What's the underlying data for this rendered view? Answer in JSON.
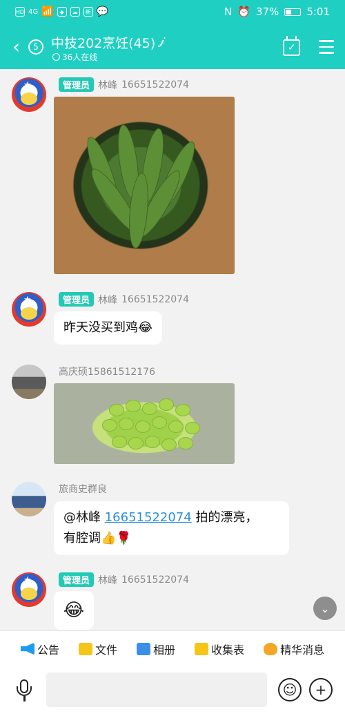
{
  "statusbar": {
    "battery": "37%",
    "time": "5:01",
    "signal": "4G"
  },
  "header": {
    "unread": "5",
    "title": "中技202烹饪(45)",
    "online": "36人在线"
  },
  "messages": [
    {
      "badge": "管理员",
      "name": "林峰",
      "phone": "16651522074",
      "type": "image"
    },
    {
      "badge": "管理员",
      "name": "林峰",
      "phone": "16651522074",
      "type": "text",
      "text": "昨天没买到鸡😂"
    },
    {
      "name": "高庆硕15861512176",
      "type": "image"
    },
    {
      "name": "旅商史群良",
      "type": "text",
      "at": "@林峰",
      "link": "16651522074",
      "line1_rest": "拍的漂亮，",
      "line2": "有腔调👍🌹"
    },
    {
      "badge": "管理员",
      "name": "林峰",
      "phone": "16651522074",
      "type": "emoji",
      "text": "😂"
    }
  ],
  "toolbar": {
    "items": [
      {
        "label": "公告",
        "icon": "megaphone-icon",
        "color": "#1e9bf0"
      },
      {
        "label": "文件",
        "icon": "folder-icon",
        "color": "#f5c518"
      },
      {
        "label": "相册",
        "icon": "album-icon",
        "color": "#3b8fe8"
      },
      {
        "label": "收集表",
        "icon": "checklist-icon",
        "color": "#f5c518"
      },
      {
        "label": "精华消息",
        "icon": "flame-icon",
        "color": "#f5a623"
      }
    ]
  },
  "input": {
    "placeholder": ""
  }
}
